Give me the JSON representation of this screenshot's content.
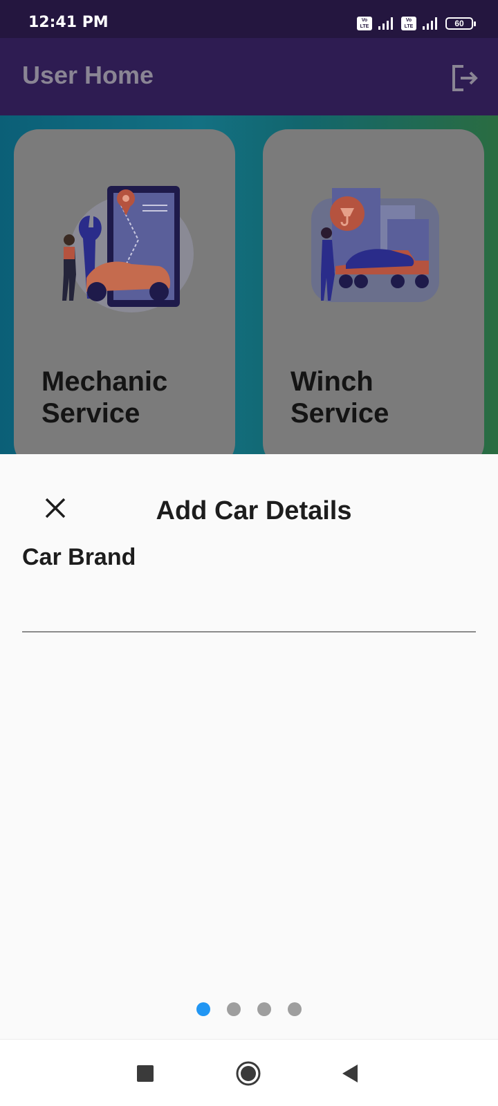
{
  "status_bar": {
    "time": "12:41 PM",
    "sim1_label": "Vo LTE",
    "sim2_label": "Vo LTE",
    "battery_level": "60"
  },
  "app_bar": {
    "title": "User Home",
    "action_icon": "logout-icon"
  },
  "services": [
    {
      "title": "Mechanic Service",
      "icon": "mechanic-illustration"
    },
    {
      "title": "Winch Service",
      "icon": "tow-truck-illustration"
    }
  ],
  "sheet": {
    "title": "Add Car Details",
    "close_icon": "close-icon",
    "field_label": "Car Brand",
    "field_value": "",
    "pages_total": 4,
    "current_page": 1
  },
  "colors": {
    "status_bar": "#24163f",
    "app_bar": "#2e1c52",
    "active_dot": "#2196f3",
    "inactive_dot": "#9e9e9e"
  },
  "nav": {
    "items": [
      "recents-icon",
      "home-icon",
      "back-icon"
    ]
  }
}
